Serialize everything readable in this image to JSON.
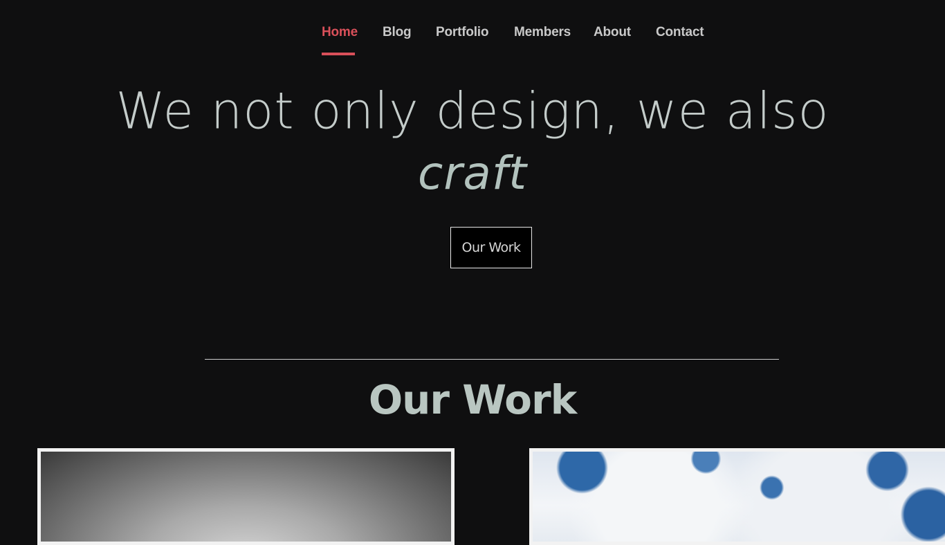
{
  "nav": {
    "items": [
      {
        "label": "Home",
        "active": true
      },
      {
        "label": "Blog",
        "active": false
      },
      {
        "label": "Portfolio",
        "active": false
      },
      {
        "label": "Members",
        "active": false
      },
      {
        "label": "About",
        "active": false
      },
      {
        "label": "Contact",
        "active": false
      }
    ]
  },
  "hero": {
    "headline": "We not only design, we also",
    "rotating_word": "craft",
    "cta_label": "Our Work"
  },
  "work_section": {
    "title": "Our Work"
  },
  "colors": {
    "background": "#0f0f10",
    "accent": "#d9505a",
    "text": "#b9c4c0"
  }
}
